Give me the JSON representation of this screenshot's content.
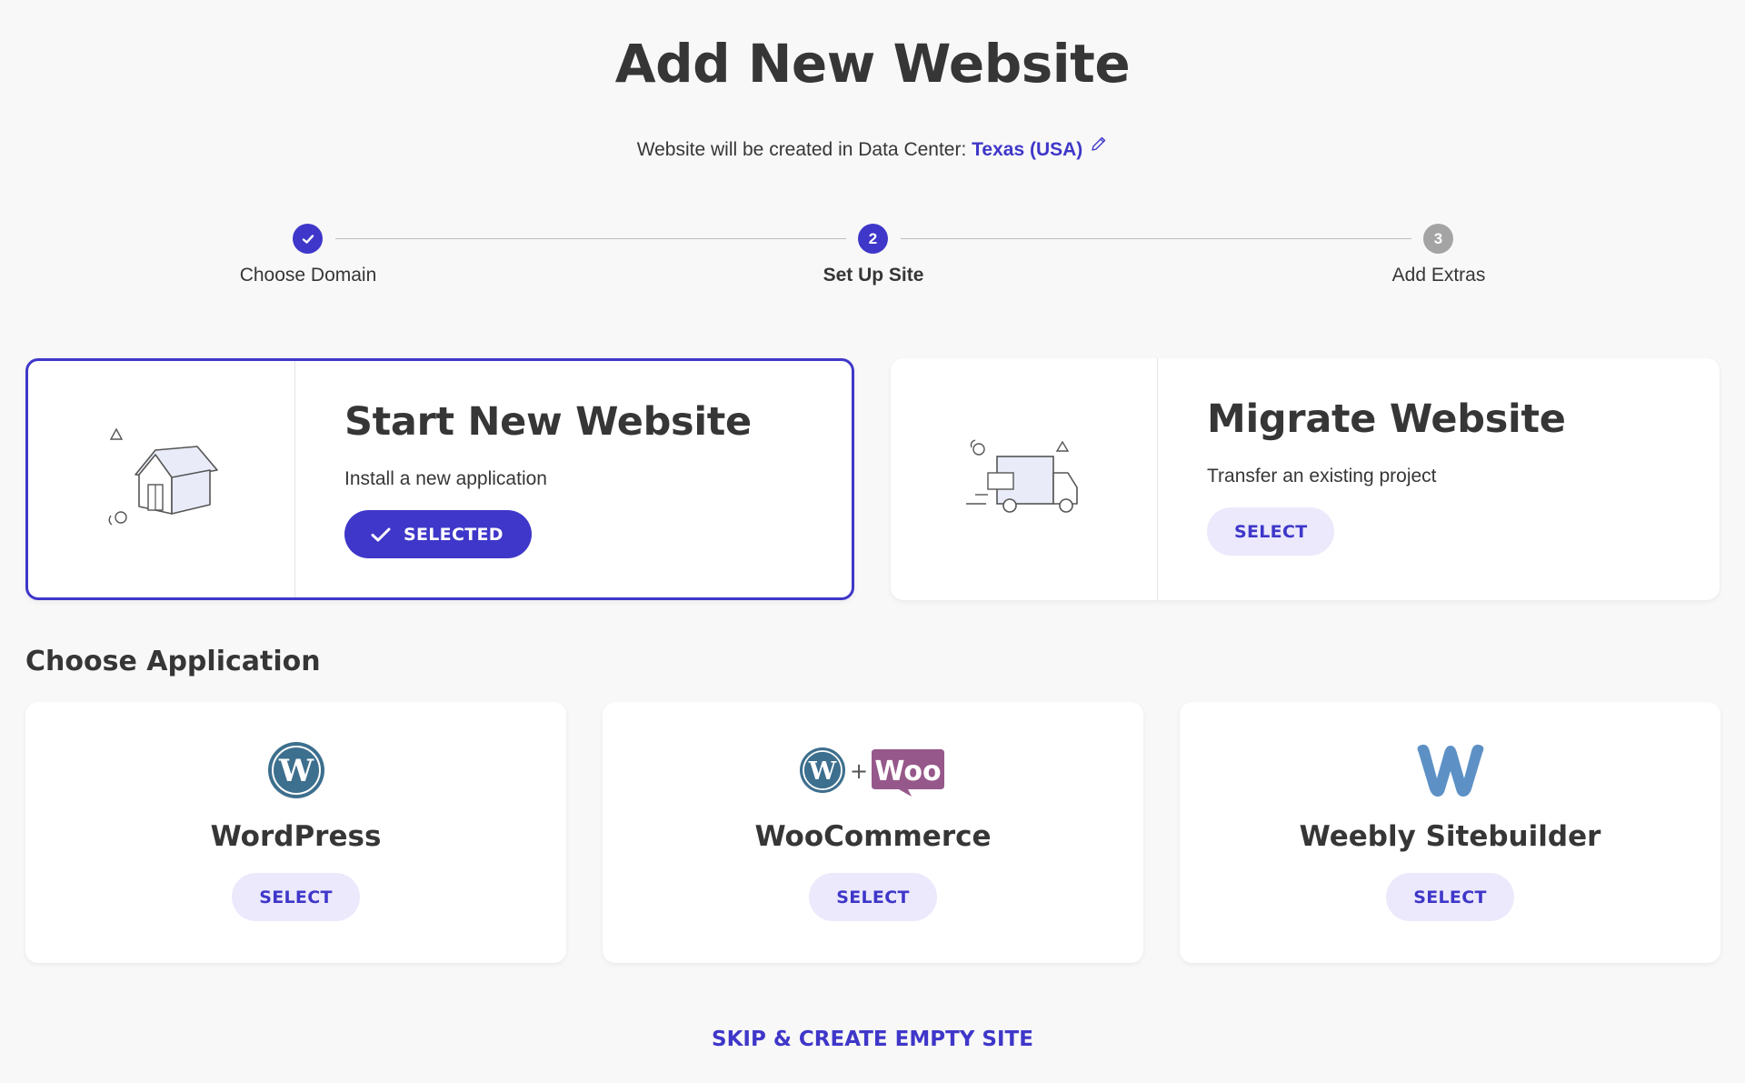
{
  "header": {
    "title": "Add New Website",
    "datacenter_prefix": "Website will be created in Data Center: ",
    "datacenter_value": "Texas (USA)"
  },
  "stepper": {
    "steps": [
      {
        "label": "Choose Domain",
        "state": "done",
        "badge": ""
      },
      {
        "label": "Set Up Site",
        "state": "current",
        "badge": "2"
      },
      {
        "label": "Add Extras",
        "state": "upcoming",
        "badge": "3"
      }
    ]
  },
  "options": {
    "start": {
      "title": "Start New Website",
      "description": "Install a new application",
      "button_label": "SELECTED",
      "icon": "house-icon"
    },
    "migrate": {
      "title": "Migrate Website",
      "description": "Transfer an existing project",
      "button_label": "SELECT",
      "icon": "truck-icon"
    }
  },
  "applications": {
    "section_title": "Choose Application",
    "items": [
      {
        "name": "WordPress",
        "button_label": "SELECT",
        "icon": "wordpress-icon"
      },
      {
        "name": "WooCommerce",
        "button_label": "SELECT",
        "icon": "woocommerce-icon",
        "logo_text": "Woo"
      },
      {
        "name": "Weebly Sitebuilder",
        "button_label": "SELECT",
        "icon": "weebly-icon"
      }
    ]
  },
  "footer": {
    "skip_label": "SKIP & CREATE EMPTY SITE"
  },
  "colors": {
    "accent": "#3f37c9",
    "accent_light": "#ebe9fb",
    "text": "#363636",
    "background": "#f8f8f8",
    "wordpress_blue": "#3d6f8e",
    "woo_purple": "#96588a",
    "weebly_blue": "#5d91c6"
  }
}
